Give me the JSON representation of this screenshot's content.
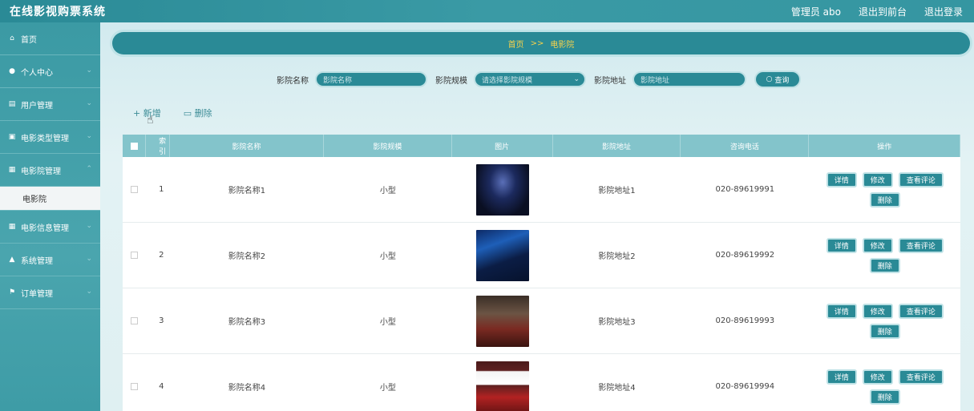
{
  "header": {
    "app_title": "在线影视购票系统",
    "admin_label": "管理员 abo",
    "back_label": "退出到前台",
    "logout_label": "退出登录"
  },
  "sidebar": {
    "items": [
      {
        "label": "首页",
        "icon": "home-icon"
      },
      {
        "label": "个人中心",
        "icon": "user-icon"
      },
      {
        "label": "用户管理",
        "icon": "users-icon"
      },
      {
        "label": "电影类型管理",
        "icon": "film-type-icon"
      },
      {
        "label": "电影院管理",
        "icon": "cinema-icon",
        "sub": "电影院"
      },
      {
        "label": "电影信息管理",
        "icon": "movie-info-icon"
      },
      {
        "label": "系统管理",
        "icon": "system-icon"
      },
      {
        "label": "订单管理",
        "icon": "order-icon"
      }
    ]
  },
  "breadcrumb": {
    "home": "首页",
    "sep": ">>",
    "current": "电影院"
  },
  "search": {
    "name_label": "影院名称",
    "name_placeholder": "影院名称",
    "size_label": "影院规模",
    "size_placeholder": "请选择影院规模",
    "addr_label": "影院地址",
    "addr_placeholder": "影院地址",
    "button": "查询"
  },
  "actions": {
    "add": "+ 新增",
    "delete": "删除"
  },
  "table": {
    "headers": [
      "索引",
      "影院名称",
      "影院规模",
      "图片",
      "影院地址",
      "咨询电话",
      "操作"
    ],
    "rows": [
      {
        "idx": "1",
        "name": "影院名称1",
        "size": "小型",
        "addr": "影院地址1",
        "tel": "020-89619991"
      },
      {
        "idx": "2",
        "name": "影院名称2",
        "size": "小型",
        "addr": "影院地址2",
        "tel": "020-89619992"
      },
      {
        "idx": "3",
        "name": "影院名称3",
        "size": "小型",
        "addr": "影院地址3",
        "tel": "020-89619993"
      },
      {
        "idx": "4",
        "name": "影院名称4",
        "size": "小型",
        "addr": "影院地址4",
        "tel": "020-89619994"
      }
    ],
    "ops": {
      "detail": "详情",
      "edit": "修改",
      "reviews": "查看评论",
      "delete": "删除"
    }
  },
  "colors": {
    "primary": "#2a8a96",
    "header_row": "#83c4cb",
    "crumb_text": "#f6d24b"
  }
}
